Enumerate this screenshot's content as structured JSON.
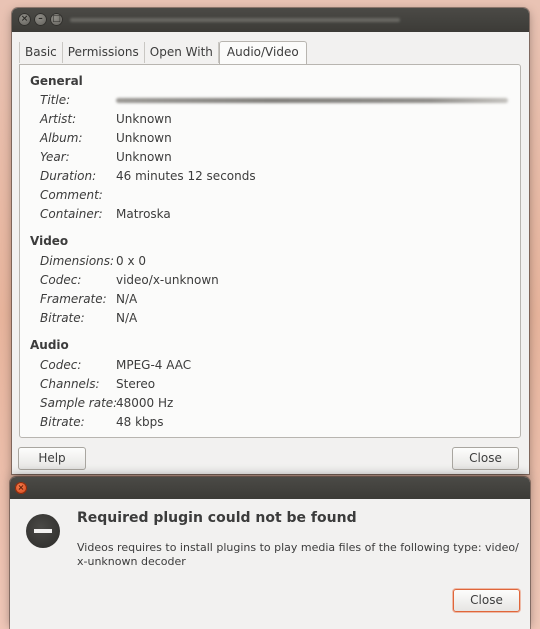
{
  "window": {
    "tabs": [
      {
        "label": "Basic"
      },
      {
        "label": "Permissions"
      },
      {
        "label": "Open With"
      },
      {
        "label": "Audio/Video",
        "active": true
      }
    ],
    "sections": {
      "general": {
        "title": "General",
        "rows": [
          {
            "label": "Title:",
            "value": ""
          },
          {
            "label": "Artist:",
            "value": "Unknown"
          },
          {
            "label": "Album:",
            "value": "Unknown"
          },
          {
            "label": "Year:",
            "value": "Unknown"
          },
          {
            "label": "Duration:",
            "value": "46 minutes 12 seconds"
          },
          {
            "label": "Comment:",
            "value": ""
          },
          {
            "label": "Container:",
            "value": "Matroska"
          }
        ]
      },
      "video": {
        "title": "Video",
        "rows": [
          {
            "label": "Dimensions:",
            "value": "0 x 0"
          },
          {
            "label": "Codec:",
            "value": "video/x-unknown"
          },
          {
            "label": "Framerate:",
            "value": "N/A"
          },
          {
            "label": "Bitrate:",
            "value": "N/A"
          }
        ]
      },
      "audio": {
        "title": "Audio",
        "rows": [
          {
            "label": "Codec:",
            "value": "MPEG-4 AAC"
          },
          {
            "label": "Channels:",
            "value": "Stereo"
          },
          {
            "label": "Sample rate:",
            "value": "48000 Hz"
          },
          {
            "label": "Bitrate:",
            "value": "48 kbps"
          }
        ]
      }
    },
    "buttons": {
      "help": "Help",
      "close": "Close"
    }
  },
  "dialog": {
    "heading": "Required plugin could not be found",
    "message": "Videos requires to install plugins to play media files of the following type: video/ x-unknown decoder",
    "close_label": "Close",
    "icon": "error-icon"
  },
  "colors": {
    "accent_orange": "#e0663a",
    "titlebar": "#3c3b37",
    "window_bg": "#f2f1f0"
  }
}
